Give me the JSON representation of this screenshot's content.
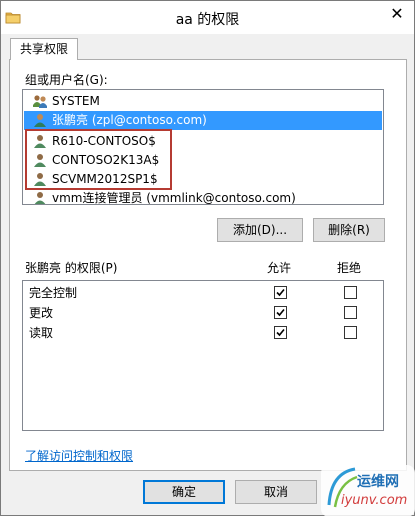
{
  "window": {
    "title": "aa 的权限",
    "close_glyph": "✕"
  },
  "tabs": [
    {
      "label": "共享权限",
      "active": true
    }
  ],
  "users": {
    "group_label": "组或用户名(G):",
    "items": [
      {
        "name": "SYSTEM",
        "icon": "system-users-icon",
        "selected": false
      },
      {
        "name": "张鹏亮 (zpl@contoso.com)",
        "icon": "user-icon",
        "selected": true
      },
      {
        "name": "R610-CONTOSO$",
        "icon": "user-icon",
        "selected": false
      },
      {
        "name": "CONTOSO2K13A$",
        "icon": "user-icon",
        "selected": false
      },
      {
        "name": "SCVMM2012SP1$",
        "icon": "user-icon",
        "selected": false
      },
      {
        "name": "vmm连接管理员 (vmmlink@contoso.com)",
        "icon": "user-icon",
        "selected": false
      }
    ],
    "add_button": "添加(D)...",
    "remove_button": "删除(R)"
  },
  "permissions": {
    "label": "张鹏亮 的权限(P)",
    "allow_header": "允许",
    "deny_header": "拒绝",
    "rows": [
      {
        "name": "完全控制",
        "allow": true,
        "deny": false
      },
      {
        "name": "更改",
        "allow": true,
        "deny": false
      },
      {
        "name": "读取",
        "allow": true,
        "deny": false
      }
    ]
  },
  "link_text": "了解访问控制和权限",
  "footer": {
    "ok_button": "确定",
    "cancel_button": "取消"
  },
  "watermark": {
    "cn": "运维网",
    "url": "iyunv.com"
  },
  "colors": {
    "selection": "#3399ff",
    "highlight_box": "#b53b32",
    "link": "#0066cc"
  }
}
